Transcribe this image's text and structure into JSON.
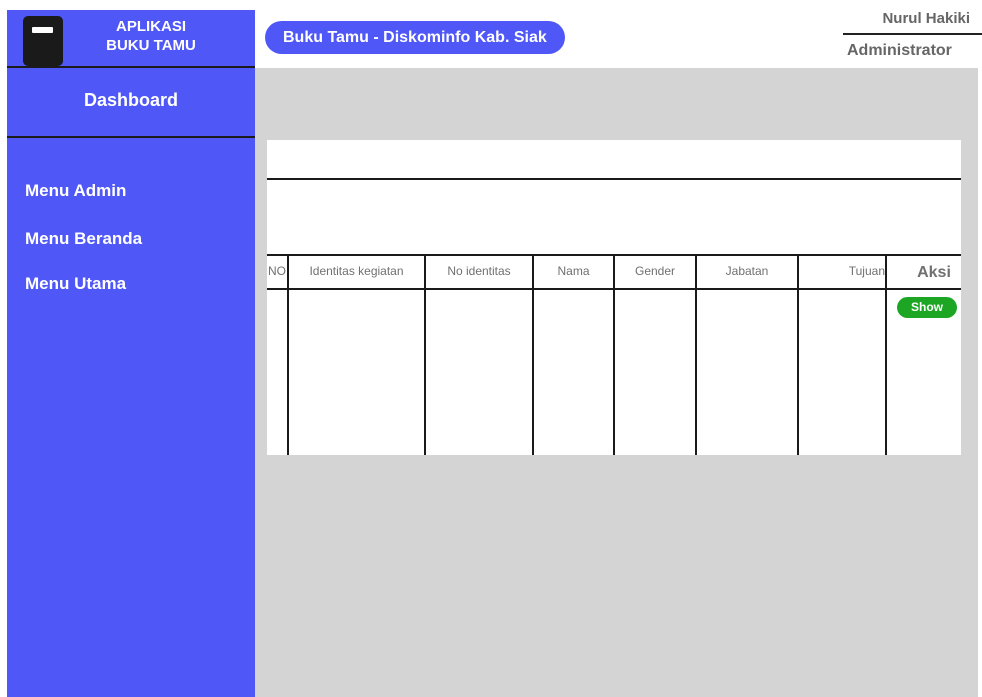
{
  "sidebar": {
    "app_title_line1": "APLIKASI",
    "app_title_line2": "BUKU TAMU",
    "dashboard_label": "Dashboard",
    "items": [
      {
        "label": "Menu Admin"
      },
      {
        "label": "Menu Beranda"
      },
      {
        "label": "Menu Utama"
      }
    ]
  },
  "header": {
    "title": "Buku Tamu - Diskominfo Kab. Siak",
    "user_name": "Nurul Hakiki",
    "user_role": "Administrator"
  },
  "table": {
    "columns": [
      "NO",
      "Identitas kegiatan",
      "No identitas",
      "Nama",
      "Gender",
      "Jabatan",
      "Tujuan"
    ],
    "action_header": "Aksi",
    "show_label": "Show"
  },
  "colors": {
    "sidebar": "#4f57f7",
    "content_bg": "#d4d4d4",
    "show_button": "#1da623"
  }
}
